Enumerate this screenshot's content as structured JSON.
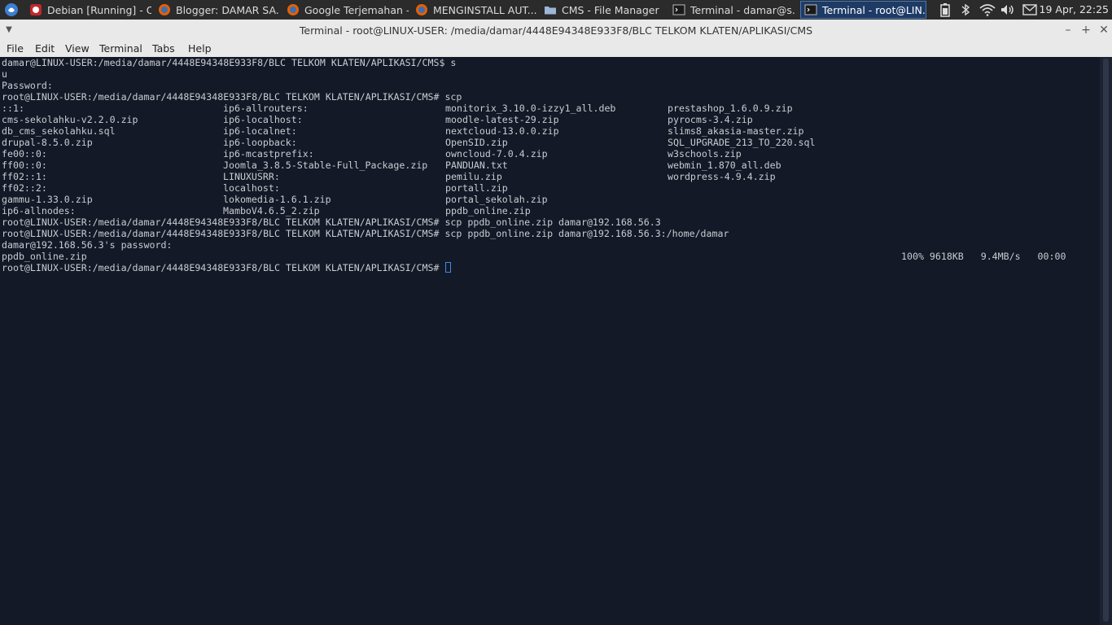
{
  "taskbar": {
    "tasks": [
      {
        "label": "Debian [Running] - O...",
        "icon": "virtualbox-icon"
      },
      {
        "label": "Blogger: DAMAR SA...",
        "icon": "firefox-icon"
      },
      {
        "label": "Google Terjemahan -...",
        "icon": "firefox-icon"
      },
      {
        "label": "MENGINSTALL AUT...",
        "icon": "firefox-icon"
      },
      {
        "label": "CMS - File Manager",
        "icon": "folder-icon"
      },
      {
        "label": "Terminal - damar@s...",
        "icon": "terminal-icon"
      },
      {
        "label": "Terminal - root@LIN...",
        "icon": "terminal-icon",
        "active": true
      }
    ],
    "clock": "19 Apr, 22:25",
    "tray": [
      "battery-icon",
      "bluetooth-icon",
      "wifi-icon",
      "volume-icon",
      "mail-icon"
    ]
  },
  "window": {
    "title": "Terminal - root@LINUX-USER: /media/damar/4448E94348E933F8/BLC TELKOM KLATEN/APLIKASI/CMS",
    "menu": [
      "File",
      "Edit",
      "View",
      "Terminal",
      "Tabs",
      "Help"
    ]
  },
  "terminal": {
    "lines": [
      "damar@LINUX-USER:/media/damar/4448E94348E933F8/BLC TELKOM KLATEN/APLIKASI/CMS$ s",
      "u",
      "Password:",
      "root@LINUX-USER:/media/damar/4448E94348E933F8/BLC TELKOM KLATEN/APLIKASI/CMS# scp"
    ],
    "listing_rows": [
      [
        "::1:",
        "ip6-allrouters:",
        "monitorix_3.10.0-izzy1_all.deb",
        "prestashop_1.6.0.9.zip"
      ],
      [
        "cms-sekolahku-v2.2.0.zip",
        "ip6-localhost:",
        "moodle-latest-29.zip",
        "pyrocms-3.4.zip"
      ],
      [
        "db_cms_sekolahku.sql",
        "ip6-localnet:",
        "nextcloud-13.0.0.zip",
        "slims8_akasia-master.zip"
      ],
      [
        "drupal-8.5.0.zip",
        "ip6-loopback:",
        "OpenSID.zip",
        "SQL_UPGRADE_213_TO_220.sql"
      ],
      [
        "fe00::0:",
        "ip6-mcastprefix:",
        "owncloud-7.0.4.zip",
        "w3schools.zip"
      ],
      [
        "ff00::0:",
        "Joomla_3.8.5-Stable-Full_Package.zip",
        "PANDUAN.txt",
        "webmin_1.870_all.deb"
      ],
      [
        "ff02::1:",
        "LINUXUSRR:",
        "pemilu.zip",
        "wordpress-4.9.4.zip"
      ],
      [
        "ff02::2:",
        "localhost:",
        "portall.zip",
        ""
      ],
      [
        "gammu-1.33.0.zip",
        "lokomedia-1.6.1.zip",
        "portal_sekolah.zip",
        ""
      ],
      [
        "ip6-allnodes:",
        "MamboV4.6.5_2.zip",
        "ppdb_online.zip",
        ""
      ]
    ],
    "after_lines": [
      "root@LINUX-USER:/media/damar/4448E94348E933F8/BLC TELKOM KLATEN/APLIKASI/CMS# scp ppdb_online.zip damar@192.168.56.3",
      "root@LINUX-USER:/media/damar/4448E94348E933F8/BLC TELKOM KLATEN/APLIKASI/CMS# scp ppdb_online.zip damar@192.168.56.3:/home/damar",
      "damar@192.168.56.3's password:"
    ],
    "transfer": {
      "file": "ppdb_online.zip",
      "stats": "100% 9618KB   9.4MB/s   00:00"
    },
    "prompt": "root@LINUX-USER:/media/damar/4448E94348E933F8/BLC TELKOM KLATEN/APLIKASI/CMS#"
  }
}
